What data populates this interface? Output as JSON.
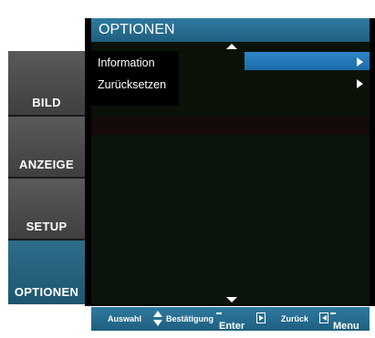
{
  "tabs": [
    {
      "label": "BILD",
      "active": false
    },
    {
      "label": "ANZEIGE",
      "active": false
    },
    {
      "label": "SETUP",
      "active": false
    },
    {
      "label": "OPTIONEN",
      "active": true
    }
  ],
  "panel": {
    "title": "OPTIONEN",
    "items": [
      {
        "label": "Information",
        "selected": true
      },
      {
        "label": "Zurücksetzen",
        "selected": false
      }
    ]
  },
  "help": {
    "select_label": "Auswahl",
    "confirm_label": "Bestätigung",
    "enter_key": "Enter",
    "back_label": "Zurück",
    "menu_key": "Menu"
  },
  "colors": {
    "accent": "#2a6f92",
    "highlight": "#2a7cc0",
    "tab_gray": "#4a4a4a",
    "panel_bg": "#000000"
  }
}
